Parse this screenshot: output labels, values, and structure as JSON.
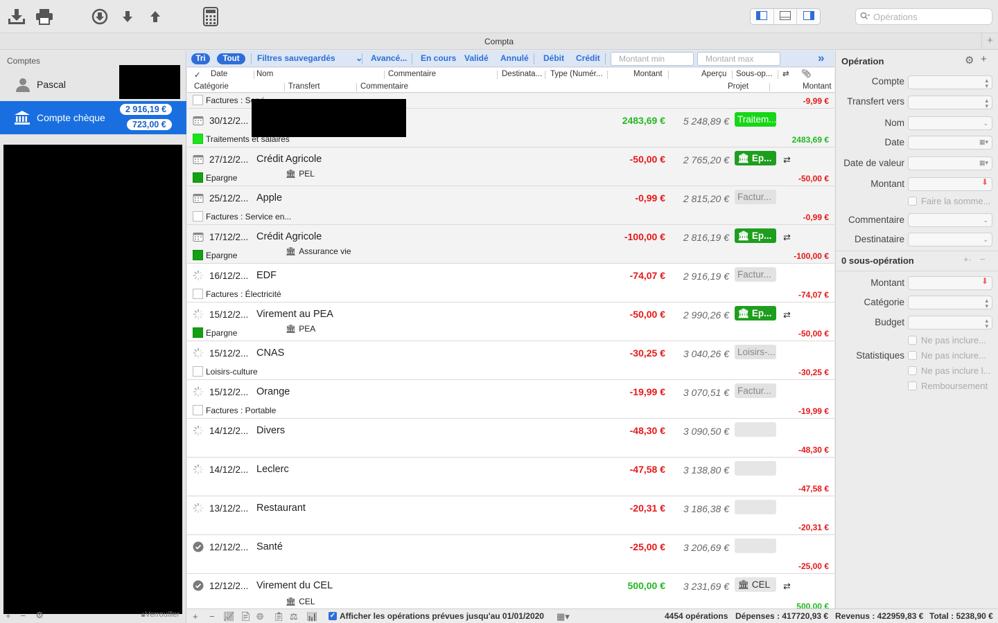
{
  "toolbar": {
    "icons": [
      "download-icon",
      "print-icon",
      "circle-down-icon",
      "arrow-down-icon",
      "arrow-up-icon",
      "calculator-icon"
    ],
    "search_placeholder": "Opérations"
  },
  "window": {
    "title": "Compta"
  },
  "sidebar": {
    "header": "Comptes",
    "user": "Pascal",
    "account": {
      "name": "Compte chèque",
      "balance1": "2 916,19 €",
      "balance2": "723,00 €"
    },
    "lock_label": "Verrouiller"
  },
  "filters": {
    "tri": "Tri",
    "tout": "Tout",
    "saved": "Filtres sauvegardés",
    "advanced": "Avancé...",
    "en_cours": "En cours",
    "valide": "Validé",
    "annule": "Annulé",
    "debit": "Débit",
    "credit": "Crédit",
    "montant_min": "Montant min",
    "montant_max": "Montant max"
  },
  "columns": {
    "check": "✓",
    "date": "Date",
    "nom": "Nom",
    "commentaire": "Commentaire",
    "destinataire": "Destinata...",
    "type": "Type (Numér...",
    "montant": "Montant",
    "apercu": "Aperçu",
    "sousop": "Sous-op...",
    "categorie": "Catégorie",
    "transfert": "Transfert",
    "commentaire2": "Commentaire",
    "projet": "Projet",
    "montant2": "Montant"
  },
  "partial_row": {
    "category": "Factures : Servi",
    "subamount": "-9,99 €"
  },
  "transactions": [
    {
      "date": "30/12/2...",
      "name": "",
      "amount": "2483,69 €",
      "balance": "5 248,89 €",
      "badge": "Traitem...",
      "category": "Traitements et salaires",
      "transfer": "",
      "subamount": "2483,69 €"
    },
    {
      "date": "27/12/2...",
      "name": "Crédit Agricole",
      "amount": "-50,00 €",
      "balance": "2 765,20 €",
      "badge": "Ep...",
      "category": "Epargne",
      "transfer": "PEL",
      "subamount": "-50,00 €"
    },
    {
      "date": "25/12/2...",
      "name": "Apple",
      "amount": "-0,99 €",
      "balance": "2 815,20 €",
      "badge": "Factur...",
      "category": "Factures : Service en...",
      "transfer": "",
      "subamount": "-0,99 €"
    },
    {
      "date": "17/12/2...",
      "name": "Crédit Agricole",
      "amount": "-100,00 €",
      "balance": "2 816,19 €",
      "badge": "Ep...",
      "category": "Epargne",
      "transfer": "Assurance vie",
      "subamount": "-100,00 €"
    },
    {
      "date": "16/12/2...",
      "name": "EDF",
      "amount": "-74,07 €",
      "balance": "2 916,19 €",
      "badge": "Factur...",
      "category": "Factures : Électricité",
      "transfer": "",
      "subamount": "-74,07 €"
    },
    {
      "date": "15/12/2...",
      "name": "Virement au PEA",
      "amount": "-50,00 €",
      "balance": "2 990,26 €",
      "badge": "Ep...",
      "category": "Epargne",
      "transfer": "PEA",
      "subamount": "-50,00 €"
    },
    {
      "date": "15/12/2...",
      "name": "CNAS",
      "amount": "-30,25 €",
      "balance": "3 040,26 €",
      "badge": "Loisirs-...",
      "category": "Loisirs-culture",
      "transfer": "",
      "subamount": "-30,25 €"
    },
    {
      "date": "15/12/2...",
      "name": "Orange",
      "amount": "-19,99 €",
      "balance": "3 070,51 €",
      "badge": "Factur...",
      "category": "Factures : Portable",
      "transfer": "",
      "subamount": "-19,99 €"
    },
    {
      "date": "14/12/2...",
      "name": "Divers",
      "amount": "-48,30 €",
      "balance": "3 090,50 €",
      "badge": "",
      "category": "",
      "transfer": "",
      "subamount": "-48,30 €"
    },
    {
      "date": "14/12/2...",
      "name": "Leclerc",
      "amount": "-47,58 €",
      "balance": "3 138,80 €",
      "badge": "",
      "category": "",
      "transfer": "",
      "subamount": "-47,58 €"
    },
    {
      "date": "13/12/2...",
      "name": "Restaurant",
      "amount": "-20,31 €",
      "balance": "3 186,38 €",
      "badge": "",
      "category": "",
      "transfer": "",
      "subamount": "-20,31 €"
    },
    {
      "date": "12/12/2...",
      "name": "Santé",
      "amount": "-25,00 €",
      "balance": "3 206,69 €",
      "badge": "",
      "category": "",
      "transfer": "",
      "subamount": "-25,00 €"
    },
    {
      "date": "12/12/2...",
      "name": "Virement du CEL",
      "amount": "500,00 €",
      "balance": "3 231,69 €",
      "badge": "CEL",
      "category": "",
      "transfer": "CEL",
      "subamount": "500,00 €"
    }
  ],
  "statusbar": {
    "show_planned": "Afficher les opérations prévues jusqu'au 01/01/2020",
    "count": "4454 opérations",
    "depenses": "Dépenses : 417720,93 €",
    "revenus": "Revenus : 422959,83 €",
    "total": "Total : 5238,90 €"
  },
  "inspector": {
    "title": "Opération",
    "compte": "Compte",
    "transfert_vers": "Transfert vers",
    "nom": "Nom",
    "date": "Date",
    "date_valeur": "Date de valeur",
    "montant": "Montant",
    "faire_somme": "Faire la somme...",
    "commentaire": "Commentaire",
    "destinataire": "Destinataire",
    "sous_op_title": "0 sous-opération",
    "sub_montant": "Montant",
    "categorie": "Catégorie",
    "budget": "Budget",
    "statistiques": "Statistiques",
    "ne_pas_1": "Ne pas inclure...",
    "ne_pas_2": "Ne pas inclure...",
    "ne_pas_3": "Ne pas inclure l...",
    "remboursement": "Remboursement"
  },
  "colors": {
    "accent": "#1a6fe0",
    "negative": "#e61717",
    "positive": "#22b822",
    "badge_green": "#1e9e1e",
    "badge_lime": "#17d617"
  }
}
